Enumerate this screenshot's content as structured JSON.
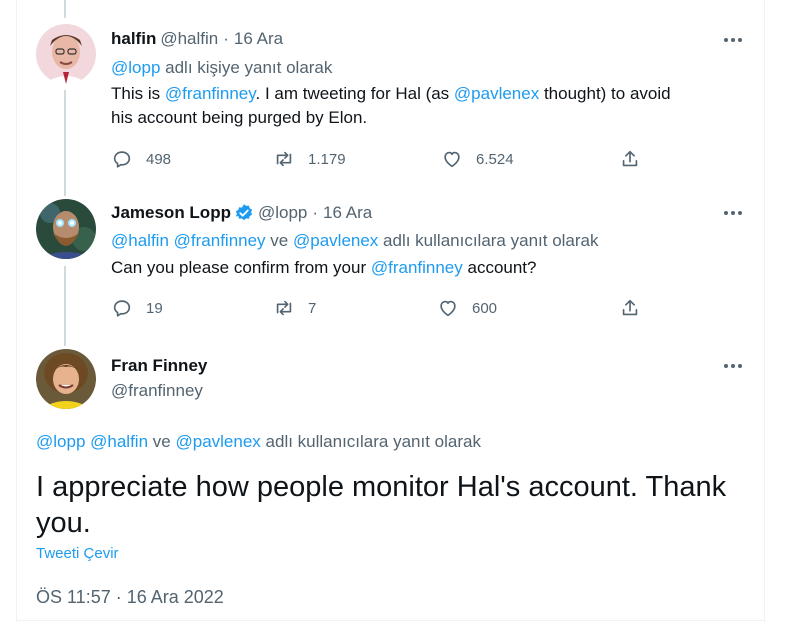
{
  "tweets": [
    {
      "name": "halfin",
      "handle": "@halfin",
      "separator": "·",
      "date": "16 Ara",
      "reply_mentions": [
        "@lopp"
      ],
      "reply_joiner": "",
      "reply_suffix": "adlı kişiye yanıt olarak",
      "text_line1_a": "This is ",
      "text_line1_mention1": "@franfinney",
      "text_line1_b": ". I am tweeting for Hal (as ",
      "text_line1_mention2": "@pavlenex",
      "text_line1_c": " thought) to avoid",
      "text_line2": "his account being purged by Elon.",
      "replies": "498",
      "retweets": "1.179",
      "likes": "6.524"
    },
    {
      "name": "Jameson Lopp",
      "handle": "@lopp",
      "separator": "·",
      "date": "16 Ara",
      "reply_mention1": "@halfin",
      "reply_mention2": "@franfinney",
      "reply_joiner": "ve",
      "reply_mention3": "@pavlenex",
      "reply_suffix": "adlı kullanıcılara yanıt olarak",
      "text_a": "Can you please confirm from your ",
      "text_mention": "@franfinney",
      "text_b": " account?",
      "replies": "19",
      "retweets": "7",
      "likes": "600"
    }
  ],
  "focused": {
    "name": "Fran Finney",
    "handle": "@franfinney",
    "reply_mention1": "@lopp",
    "reply_mention2": "@halfin",
    "reply_joiner": "ve",
    "reply_mention3": "@pavlenex",
    "reply_suffix": "adlı kullanıcılara yanıt olarak",
    "text": "I appreciate how people monitor Hal's account. Thank you.",
    "translate_label": "Tweeti Çevir",
    "timestamp": "ÖS 11:57 · 16 Ara 2022"
  },
  "icons": {
    "more": "more-horizontal-icon",
    "reply": "reply-icon",
    "retweet": "retweet-icon",
    "like": "heart-icon",
    "share": "share-icon",
    "verified": "verified-badge-icon"
  },
  "colors": {
    "link": "#1d9bf0",
    "secondary": "#536471",
    "text": "#0f1419",
    "thread_line": "#cfd9de"
  }
}
